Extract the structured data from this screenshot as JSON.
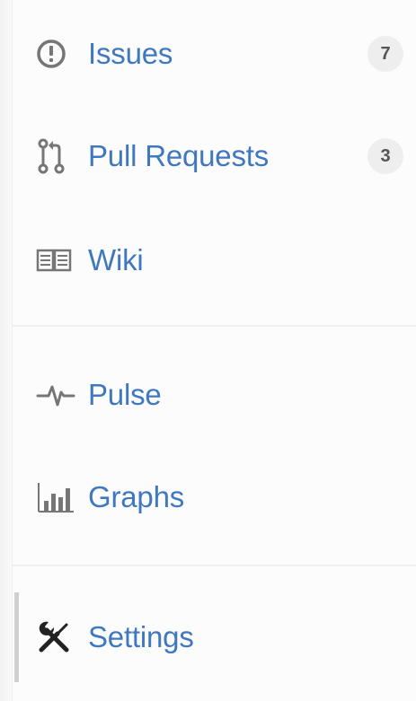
{
  "nav": {
    "group1": [
      {
        "id": "issues",
        "label": "Issues",
        "icon": "issue-opened-icon",
        "count": "7"
      },
      {
        "id": "pull-requests",
        "label": "Pull Requests",
        "icon": "git-pull-request-icon",
        "count": "3"
      },
      {
        "id": "wiki",
        "label": "Wiki",
        "icon": "book-icon"
      }
    ],
    "group2": [
      {
        "id": "pulse",
        "label": "Pulse",
        "icon": "pulse-icon"
      },
      {
        "id": "graphs",
        "label": "Graphs",
        "icon": "graph-icon"
      }
    ],
    "group3": [
      {
        "id": "settings",
        "label": "Settings",
        "icon": "tools-icon",
        "selected": true
      }
    ]
  },
  "colors": {
    "link": "#4078c0",
    "icon": "#767676",
    "counter_bg": "#eeeeee",
    "counter_text": "#555555",
    "selected_bar": "#d0d0d0"
  }
}
